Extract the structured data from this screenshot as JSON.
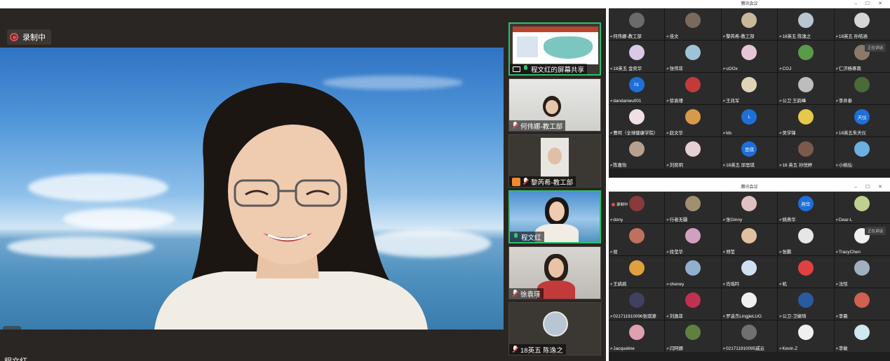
{
  "main": {
    "recording_label": "录制中",
    "speaker_name": "程文红",
    "colors": {
      "recording": "#e94b4b",
      "active_border": "#2dbf6a"
    }
  },
  "strip": {
    "thumbs": [
      {
        "label": "程文红的屏幕共享",
        "icon": "screen-share-icon"
      },
      {
        "label": "何伟娜-教工部",
        "icon": "mic-muted-icon"
      },
      {
        "label": "黎芮希-教工部",
        "icon": "mic-muted-icon"
      },
      {
        "label": "程文红",
        "icon": "mic-active-icon"
      },
      {
        "label": "徐袁瑾",
        "icon": "mic-muted-icon"
      },
      {
        "label": "18英五 陈逸之",
        "icon": "mic-muted-icon"
      }
    ]
  },
  "gallery_top": {
    "title": "腾讯会议",
    "window_controls": "– ☐ ✕",
    "badge": "正在讲话",
    "participants": [
      {
        "name": "何伟娜-教工部",
        "avatar": "",
        "color": "#6b6b6b"
      },
      {
        "name": "佳文",
        "avatar": "",
        "color": "#7a6a5e"
      },
      {
        "name": "黎芮希-教工部",
        "avatar": "",
        "color": "#c9b89a"
      },
      {
        "name": "18英五 陈逸之",
        "avatar": "",
        "color": "#b8c6d4"
      },
      {
        "name": "18英五 孙皓涵",
        "avatar": "",
        "color": "#d6d6d6"
      },
      {
        "name": "18英五 金奕华",
        "avatar": "",
        "color": "#d9c8e6"
      },
      {
        "name": "张伟菲",
        "avatar": "",
        "color": "#9fc3d6"
      },
      {
        "name": "uOOx",
        "avatar": "",
        "color": "#e6c6d6"
      },
      {
        "name": "CGJ",
        "avatar": "",
        "color": "#5a9a4a"
      },
      {
        "name": "仁济杨寒南",
        "avatar": "",
        "color": "#8a7a6a"
      },
      {
        "name": "dandanwu001",
        "avatar": "01",
        "color": "#1e6fd9"
      },
      {
        "name": "徐袁瑾",
        "avatar": "",
        "color": "#c23a3a"
      },
      {
        "name": "王兆军",
        "avatar": "",
        "color": "#e0d4b8"
      },
      {
        "name": "公卫 王韵峰",
        "avatar": "",
        "color": "#bdbdbd"
      },
      {
        "name": "李井泰",
        "avatar": "",
        "color": "#4a6a3a"
      },
      {
        "name": "曹珂（全球健康学院）",
        "avatar": "",
        "color": "#f0e0e6"
      },
      {
        "name": "赵文华",
        "avatar": "",
        "color": "#d89a4a"
      },
      {
        "name": "lds",
        "avatar": "L",
        "color": "#1e6fd9"
      },
      {
        "name": "吴学锋",
        "avatar": "",
        "color": "#e6c84a"
      },
      {
        "name": "18英五朱天仪",
        "avatar": "天仪",
        "color": "#1e6fd9"
      },
      {
        "name": "陈嘉怡",
        "avatar": "",
        "color": "#b8a090"
      },
      {
        "name": "刘奕玥",
        "avatar": "",
        "color": "#e6d0d6"
      },
      {
        "name": "18英五 邱思琪",
        "avatar": "思琪",
        "color": "#1e6fd9"
      },
      {
        "name": "18 英五 孙悦婷",
        "avatar": "",
        "color": "#7a5a4a"
      },
      {
        "name": "小桃仙",
        "avatar": "",
        "color": "#6ab0e0"
      }
    ]
  },
  "gallery_bottom": {
    "title": "腾讯会议",
    "window_controls": "– ☐ ✕",
    "recording_label": "录制中",
    "badge": "正在讲话",
    "participants": [
      {
        "name": "dony",
        "avatar": "",
        "color": "#8a3a3a"
      },
      {
        "name": "行者无疆",
        "avatar": "",
        "color": "#a09070"
      },
      {
        "name": "张Ginny",
        "avatar": "",
        "color": "#e0c0c0"
      },
      {
        "name": "姚燕华",
        "avatar": "燕华",
        "color": "#1e6fd9"
      },
      {
        "name": "Dear-L",
        "avatar": "",
        "color": "#c0d090"
      },
      {
        "name": "屈",
        "avatar": "",
        "color": "#c07060"
      },
      {
        "name": "段莹华",
        "avatar": "",
        "color": "#d0a0c0"
      },
      {
        "name": "郑莹",
        "avatar": "",
        "color": "#e0c0a0"
      },
      {
        "name": "张鹏",
        "avatar": "",
        "color": "#e6e6e6"
      },
      {
        "name": "TracyChen",
        "avatar": "",
        "color": "#f0f0f0"
      },
      {
        "name": "王鹃鹃",
        "avatar": "",
        "color": "#e0a040"
      },
      {
        "name": "cheney",
        "avatar": "",
        "color": "#90b0d0"
      },
      {
        "name": "肖瑶吟",
        "avatar": "",
        "color": "#d0e0f0"
      },
      {
        "name": "机",
        "avatar": "",
        "color": "#e04040"
      },
      {
        "name": "沈恬",
        "avatar": "",
        "color": "#a0b0c0"
      },
      {
        "name": "021711910096张琪源",
        "avatar": "",
        "color": "#404060"
      },
      {
        "name": "刘逸菲",
        "avatar": "",
        "color": "#c03050"
      },
      {
        "name": "罗凌杰LingjieLUO",
        "avatar": "",
        "color": "#f0f0f0"
      },
      {
        "name": "公卫-卫婕琦",
        "avatar": "",
        "color": "#2a5aa0"
      },
      {
        "name": "李晨",
        "avatar": "",
        "color": "#d06050"
      },
      {
        "name": "Jacqueline",
        "avatar": "",
        "color": "#e0a0b0"
      },
      {
        "name": "闫阿娜",
        "avatar": "",
        "color": "#608040"
      },
      {
        "name": "021711910095戚云",
        "avatar": "",
        "color": "#707070"
      },
      {
        "name": "Kevin.Z",
        "avatar": "",
        "color": "#f0f0f0"
      },
      {
        "name": "李敏",
        "avatar": "",
        "color": "#d0e8f0"
      }
    ]
  }
}
